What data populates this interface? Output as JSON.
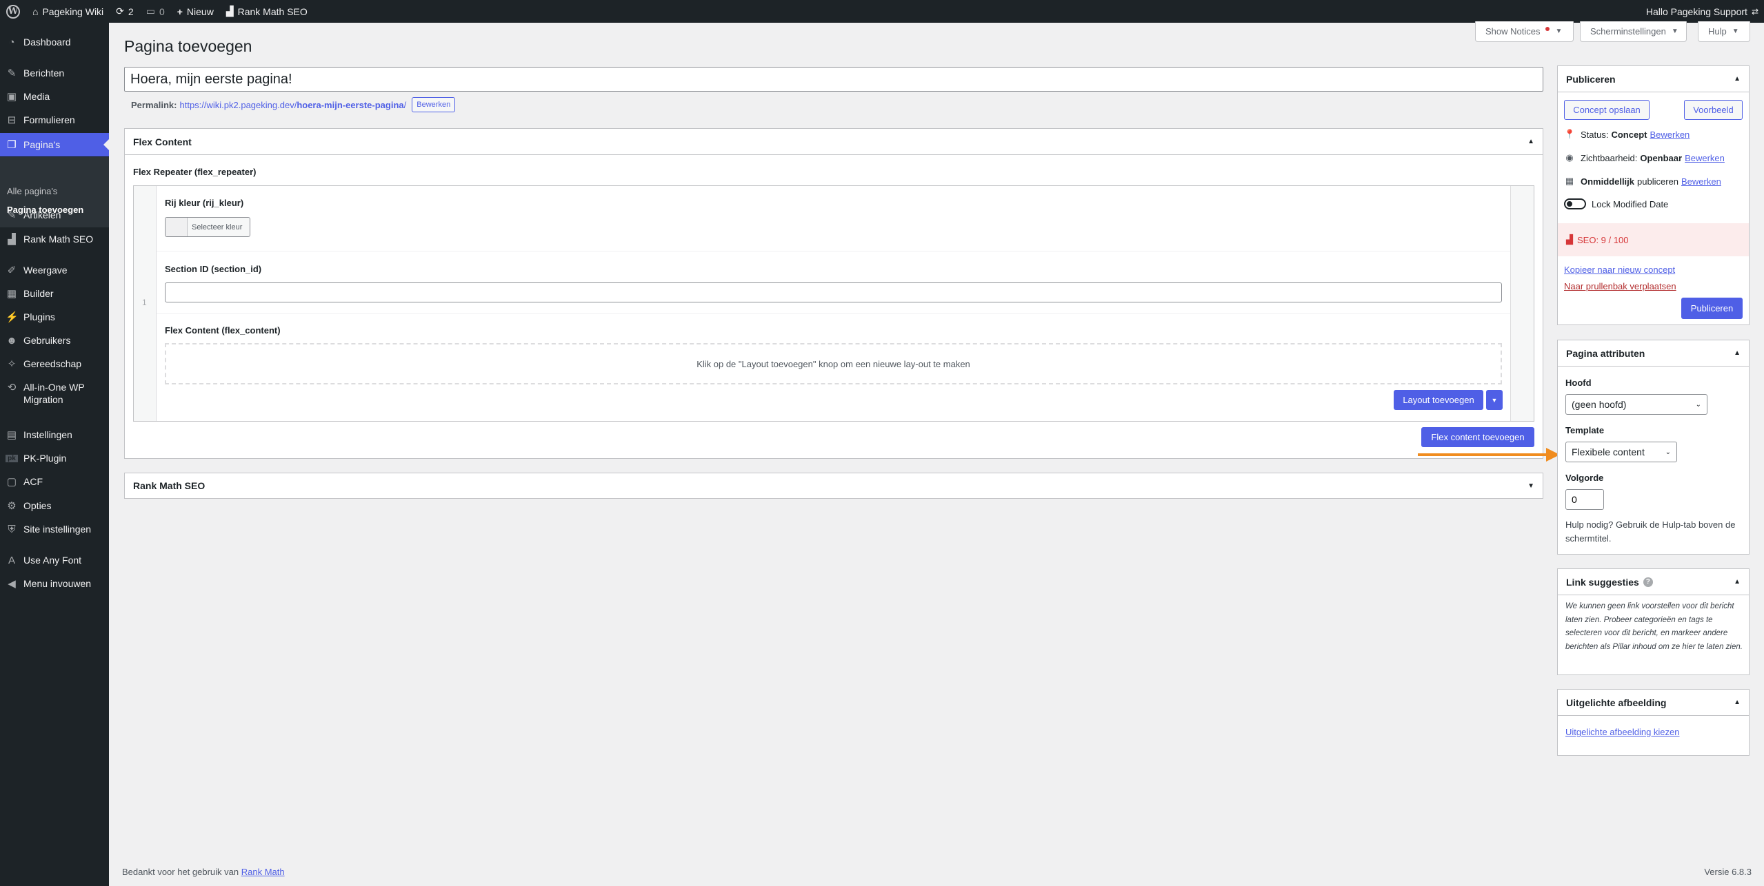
{
  "adminbar": {
    "site_name": "Pageking Wiki",
    "updates_count": "2",
    "comments_count": "0",
    "new_label": "Nieuw",
    "rankmath_label": "Rank Math SEO",
    "greeting": "Hallo Pageking Support"
  },
  "sidebar": {
    "items": [
      {
        "label": "Dashboard",
        "icon": "dashboard-icon"
      },
      {
        "label": "Berichten",
        "icon": "pin-icon"
      },
      {
        "label": "Media",
        "icon": "media-icon"
      },
      {
        "label": "Formulieren",
        "icon": "forms-icon"
      },
      {
        "label": "Pagina's",
        "icon": "pages-icon"
      },
      {
        "label": "Artikelen",
        "icon": "pin-icon"
      },
      {
        "label": "Rank Math SEO",
        "icon": "rankmath-icon"
      },
      {
        "label": "Weergave",
        "icon": "brush-icon"
      },
      {
        "label": "Builder",
        "icon": "builder-icon"
      },
      {
        "label": "Plugins",
        "icon": "plugin-icon"
      },
      {
        "label": "Gebruikers",
        "icon": "users-icon"
      },
      {
        "label": "Gereedschap",
        "icon": "wrench-icon"
      },
      {
        "label": "All-in-One WP",
        "label2": "Migration",
        "icon": "migration-icon"
      },
      {
        "label": "Instellingen",
        "icon": "settings-icon"
      },
      {
        "label": "PK-Plugin",
        "icon": "pk-icon"
      },
      {
        "label": "ACF",
        "icon": "acf-icon"
      },
      {
        "label": "Opties",
        "icon": "gear-icon"
      },
      {
        "label": "Site instellingen",
        "icon": "shield-icon"
      },
      {
        "label": "Use Any Font",
        "icon": "font-icon"
      },
      {
        "label": "Menu invouwen",
        "icon": "collapse-icon"
      }
    ],
    "submenu": {
      "all_pages": "Alle pagina's",
      "add_page": "Pagina toevoegen"
    }
  },
  "screen_meta": {
    "show_notices": "Show Notices",
    "screen_options": "Scherminstellingen",
    "help": "Hulp"
  },
  "page": {
    "heading": "Pagina toevoegen",
    "title_value": "Hoera, mijn eerste pagina!",
    "permalink_label": "Permalink:",
    "permalink_base": "https://wiki.pk2.pageking.dev/",
    "permalink_slug": "hoera-mijn-eerste-pagina",
    "permalink_end": "/",
    "permalink_edit": "Bewerken"
  },
  "flex": {
    "box_title": "Flex Content",
    "repeater_label": "Flex Repeater (flex_repeater)",
    "row_number": "1",
    "row_color_label": "Rij kleur (rij_kleur)",
    "select_color": "Selecteer kleur",
    "section_id_label": "Section ID (section_id)",
    "section_id_value": "",
    "flex_content_label": "Flex Content (flex_content)",
    "empty_message": "Klik op de \"Layout toevoegen\" knop om een nieuwe lay-out te maken",
    "add_layout": "Layout toevoegen",
    "add_flex": "Flex content toevoegen"
  },
  "rankmath_box": {
    "title": "Rank Math SEO"
  },
  "publish": {
    "title": "Publiceren",
    "save_draft": "Concept opslaan",
    "preview": "Voorbeeld",
    "status_label": "Status:",
    "status_value": "Concept",
    "visibility_label": "Zichtbaarheid:",
    "visibility_value": "Openbaar",
    "schedule_strong": "Onmiddellijk",
    "schedule_text": "publiceren",
    "edit": "Bewerken",
    "lock_modified": "Lock Modified Date",
    "seo_score": "SEO: 9 / 100",
    "copy_draft": "Kopieer naar nieuw concept",
    "trash": "Naar prullenbak verplaatsen",
    "publish_btn": "Publiceren"
  },
  "attributes": {
    "title": "Pagina attributen",
    "parent_label": "Hoofd",
    "parent_value": "(geen hoofd)",
    "template_label": "Template",
    "template_value": "Flexibele content",
    "order_label": "Volgorde",
    "order_value": "0",
    "help_text": "Hulp nodig? Gebruik de Hulp-tab boven de schermtitel."
  },
  "link_suggestions": {
    "title": "Link suggesties",
    "text": "We kunnen geen link voorstellen voor dit bericht laten zien. Probeer categorieën en tags te selecteren voor dit bericht, en markeer andere berichten als Pillar inhoud om ze hier te laten zien."
  },
  "featured_image": {
    "title": "Uitgelichte afbeelding",
    "link": "Uitgelichte afbeelding kiezen"
  },
  "footer": {
    "thanks": "Bedankt voor het gebruik van",
    "thanks_link": "Rank Math",
    "version": "Versie 6.8.3"
  },
  "colors": {
    "accent": "#4f5fe6",
    "annotation_arrow": "#f08c1f",
    "seo_bad": "#d63638"
  }
}
